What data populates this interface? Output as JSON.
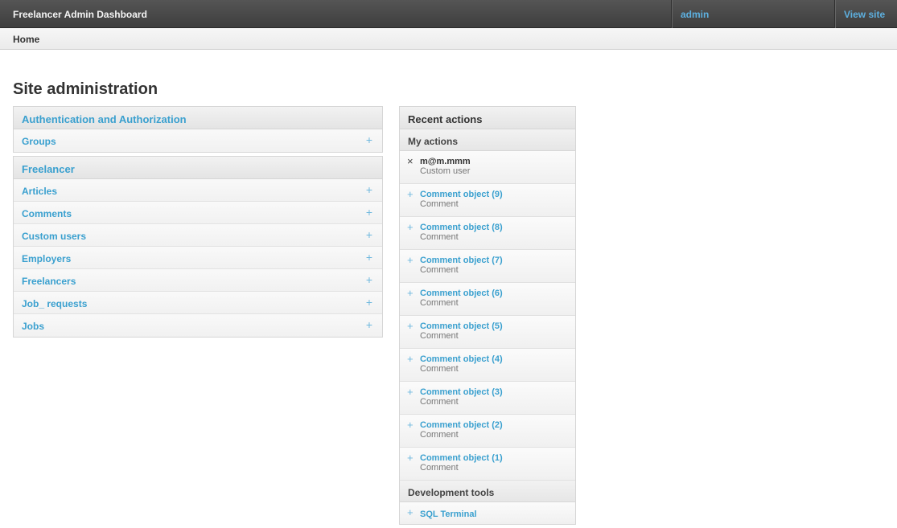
{
  "header": {
    "brand": "Freelancer Admin Dashboard",
    "user": "admin",
    "view_site": "View site"
  },
  "breadcrumbs": {
    "home": "Home"
  },
  "title": "Site administration",
  "apps": [
    {
      "name": "Authentication and Authorization",
      "models": [
        {
          "name": "Groups",
          "add": "+"
        }
      ]
    },
    {
      "name": "Freelancer",
      "models": [
        {
          "name": "Articles",
          "add": "+"
        },
        {
          "name": "Comments",
          "add": "+"
        },
        {
          "name": "Custom users",
          "add": "+"
        },
        {
          "name": "Employers",
          "add": "+"
        },
        {
          "name": "Freelancers",
          "add": "+"
        },
        {
          "name": "Job_ requests",
          "add": "+"
        },
        {
          "name": "Jobs",
          "add": "+"
        }
      ]
    }
  ],
  "recent": {
    "title": "Recent actions",
    "my_actions": "My actions",
    "items": [
      {
        "icon": "×",
        "title": "m@m.mmm",
        "type": "Custom user"
      },
      {
        "icon": "+",
        "title": "Comment object (9)",
        "type": "Comment"
      },
      {
        "icon": "+",
        "title": "Comment object (8)",
        "type": "Comment"
      },
      {
        "icon": "+",
        "title": "Comment object (7)",
        "type": "Comment"
      },
      {
        "icon": "+",
        "title": "Comment object (6)",
        "type": "Comment"
      },
      {
        "icon": "+",
        "title": "Comment object (5)",
        "type": "Comment"
      },
      {
        "icon": "+",
        "title": "Comment object (4)",
        "type": "Comment"
      },
      {
        "icon": "+",
        "title": "Comment object (3)",
        "type": "Comment"
      },
      {
        "icon": "+",
        "title": "Comment object (2)",
        "type": "Comment"
      },
      {
        "icon": "+",
        "title": "Comment object (1)",
        "type": "Comment"
      }
    ],
    "dev_title": "Development tools",
    "dev_items": [
      {
        "icon": "+",
        "title": "SQL Terminal"
      }
    ]
  },
  "colors": {
    "link": "#3aa0cf",
    "header_bg": "#4a4a4a",
    "header_link": "#5db0e0"
  }
}
